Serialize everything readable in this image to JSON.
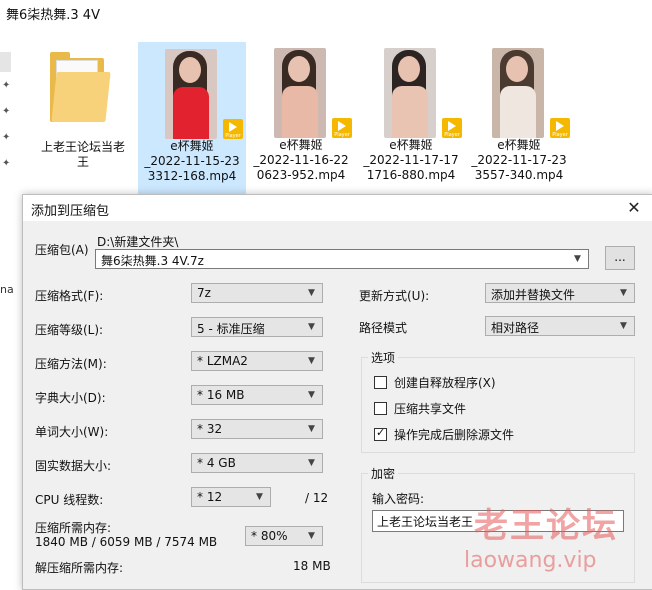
{
  "explorer": {
    "window_title": "舞6柒热舞.3 4V",
    "left_label": "na",
    "files": [
      {
        "name": "上老王论坛当老王",
        "type": "folder"
      },
      {
        "name": "e杯舞姬_2022-11-15-233312-168.mp4",
        "line1": "e杯舞姬",
        "line2": "_2022-11-15-23",
        "line3": "3312-168.mp4",
        "type": "video",
        "selected": true,
        "badge": "Player"
      },
      {
        "name": "e杯舞姬_2022-11-16-220623-952.mp4",
        "line1": "e杯舞姬",
        "line2": "_2022-11-16-22",
        "line3": "0623-952.mp4",
        "type": "video",
        "badge": "Player"
      },
      {
        "name": "e杯舞姬_2022-11-17-171716-880.mp4",
        "line1": "e杯舞姬",
        "line2": "_2022-11-17-17",
        "line3": "1716-880.mp4",
        "type": "video",
        "badge": "Player"
      },
      {
        "name": "e杯舞姬_2022-11-17-233557-340.mp4",
        "line1": "e杯舞姬",
        "line2": "_2022-11-17-23",
        "line3": "3557-340.mp4",
        "type": "video",
        "badge": "Player"
      }
    ],
    "folder_line1": "上老王论坛当老",
    "folder_line2": "王"
  },
  "dialog": {
    "title": "添加到压缩包",
    "close_glyph": "✕",
    "archive_label": "压缩包(A)",
    "archive_dir": "D:\\新建文件夹\\",
    "archive_name": "舞6柒热舞.3 4V.7z",
    "browse_label": "...",
    "format_label": "压缩格式(F):",
    "format_value": "7z",
    "level_label": "压缩等级(L):",
    "level_value": "5 - 标准压缩",
    "method_label": "压缩方法(M):",
    "method_value": "*  LZMA2",
    "dict_label": "字典大小(D):",
    "dict_value": "*  16 MB",
    "word_label": "单词大小(W):",
    "word_value": "*  32",
    "solid_label": "固实数据大小:",
    "solid_value": "*  4 GB",
    "threads_label": "CPU 线程数:",
    "threads_value": "*  12",
    "threads_total": "/ 12",
    "mem_label": "压缩所需内存:",
    "mem_value": "1840 MB / 6059 MB / 7574 MB",
    "mem_percent": "* 80%",
    "decomp_label": "解压缩所需内存:",
    "decomp_value": "18 MB",
    "update_label": "更新方式(U):",
    "update_value": "添加并替换文件",
    "path_label": "路径模式",
    "path_value": "相对路径",
    "options_title": "选项",
    "opt_sfx": "创建自释放程序(X)",
    "opt_shared": "压缩共享文件",
    "opt_delete": "操作完成后删除源文件",
    "encrypt_title": "加密",
    "password_label": "输入密码:",
    "password_value": "上老王论坛当老王"
  },
  "watermark": {
    "cn": "老王论坛",
    "en": "laowang.vip"
  },
  "colors": {
    "selection": "#cce8ff",
    "dialog_bg": "#f0f0f0",
    "folder": "#e9b94a",
    "badge": "#f5b800",
    "watermark": "#e65a5a"
  }
}
